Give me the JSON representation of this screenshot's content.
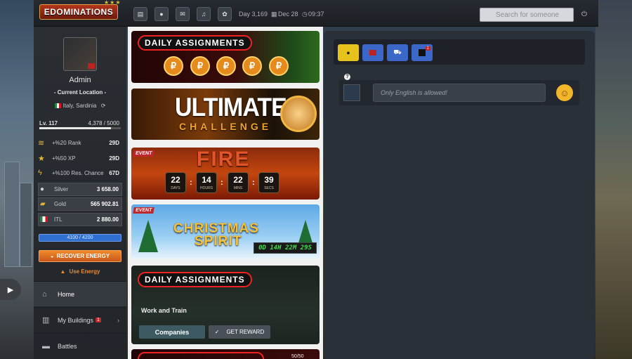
{
  "header": {
    "logo": "EDOMINATIONS",
    "stars": "★★★",
    "day": "Day 3,169",
    "date": "Dec 28",
    "time": "09:37",
    "search_placeholder": "Search for someone"
  },
  "profile": {
    "name": "Admin",
    "current_location_label": "- Current Location -",
    "location": "Italy, Sardinia",
    "level": "Lv. 117",
    "xp": "4,378 / 5000",
    "xp_fraction": 0.8756
  },
  "bonuses": [
    {
      "label": "+%20 Rank",
      "value": "29D",
      "icon": "rank-icon"
    },
    {
      "label": "+%50 XP",
      "value": "29D",
      "icon": "star-icon"
    },
    {
      "label": "+%100 Res. Chance",
      "value": "67D",
      "icon": "lightning-icon"
    }
  ],
  "resources": [
    {
      "label": "Silver",
      "value": "3 658.00",
      "icon": "silver-coin-icon"
    },
    {
      "label": "Gold",
      "value": "565 902.81",
      "icon": "gold-bars-icon"
    },
    {
      "label": "ITL",
      "value": "2 880.00",
      "icon": "italy-flag-icon"
    }
  ],
  "energy": {
    "text": "4100 / 4200",
    "recover_label": "RECOVER ENERGY",
    "use_label": "Use Energy"
  },
  "nav": [
    {
      "label": "Home",
      "badge": ""
    },
    {
      "label": "My Buildings",
      "badge": "1"
    },
    {
      "label": "Battles",
      "badge": ""
    }
  ],
  "banners": {
    "daily1_title": "DAILY ASSIGNMENTS",
    "ultimate_title": "ULTIMATE",
    "ultimate_sub": "CHALLENGE",
    "fire_event_tag": "EVENT",
    "fire_title": "FIRE",
    "fire_timer": [
      {
        "num": "22",
        "unit": "DAYS"
      },
      {
        "num": "14",
        "unit": "HOURS"
      },
      {
        "num": "22",
        "unit": "MINS"
      },
      {
        "num": "39",
        "unit": "SECS"
      }
    ],
    "xmas_event_tag": "EVENT",
    "xmas_title": "CHRISTMAS",
    "xmas_sub": "SPIRIT",
    "xmas_timer": "0D 14H 22M 29S",
    "daily2_title": "DAILY ASSIGNMENTS",
    "work_train": "Work and Train",
    "companies_btn": "Companies",
    "get_reward_btn": "GET REWARD",
    "bottom_count": "50/50"
  },
  "chat": {
    "input_placeholder": "Only English is allowed!",
    "unread_badge": "1"
  }
}
